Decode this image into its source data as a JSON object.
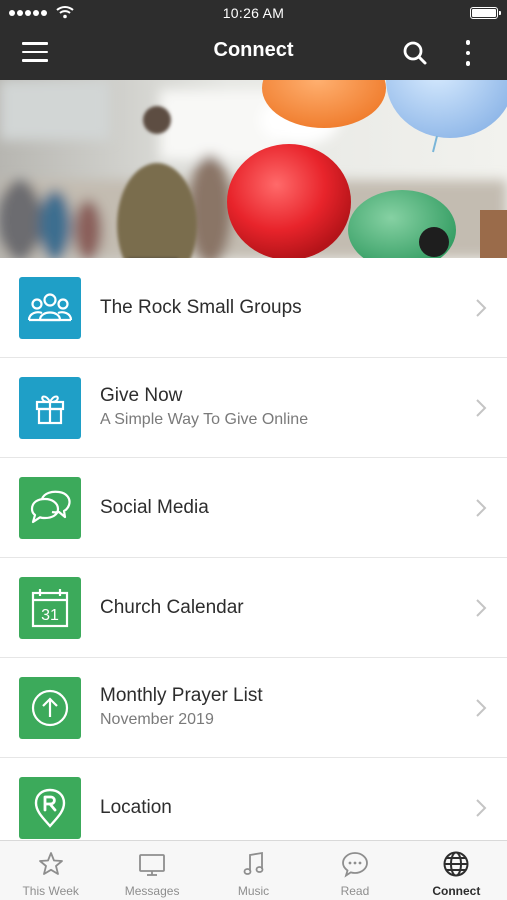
{
  "status_bar": {
    "time": "10:26 AM"
  },
  "app_bar": {
    "title": "Connect"
  },
  "list": [
    {
      "title": "The Rock Small Groups",
      "subtitle": "",
      "icon": "people-group-icon",
      "color": "#1f9fc7"
    },
    {
      "title": "Give Now",
      "subtitle": "A Simple Way To Give Online",
      "icon": "gift-icon",
      "color": "#1f9fc7"
    },
    {
      "title": "Social Media",
      "subtitle": "",
      "icon": "chat-bubbles-icon",
      "color": "#3caa5b"
    },
    {
      "title": "Church Calendar",
      "subtitle": "",
      "icon": "calendar-icon",
      "calendar_day": "31",
      "color": "#3caa5b"
    },
    {
      "title": "Monthly Prayer List",
      "subtitle": "November 2019",
      "icon": "up-arrow-circle-icon",
      "color": "#3caa5b"
    },
    {
      "title": "Location",
      "subtitle": "",
      "icon": "location-pin-icon",
      "color": "#3caa5b"
    }
  ],
  "tabs": [
    {
      "label": "This Week",
      "icon": "star-icon",
      "active": false
    },
    {
      "label": "Messages",
      "icon": "tv-icon",
      "active": false
    },
    {
      "label": "Music",
      "icon": "music-note-icon",
      "active": false
    },
    {
      "label": "Read",
      "icon": "chat-dots-icon",
      "active": false
    },
    {
      "label": "Connect",
      "icon": "globe-icon",
      "active": true
    }
  ],
  "colors": {
    "app_bar": "#2d2d2d",
    "blue_tile": "#1f9fc7",
    "green_tile": "#3caa5b",
    "active_tab": "#2d2d2d",
    "inactive_tab": "#8e8e8e"
  }
}
